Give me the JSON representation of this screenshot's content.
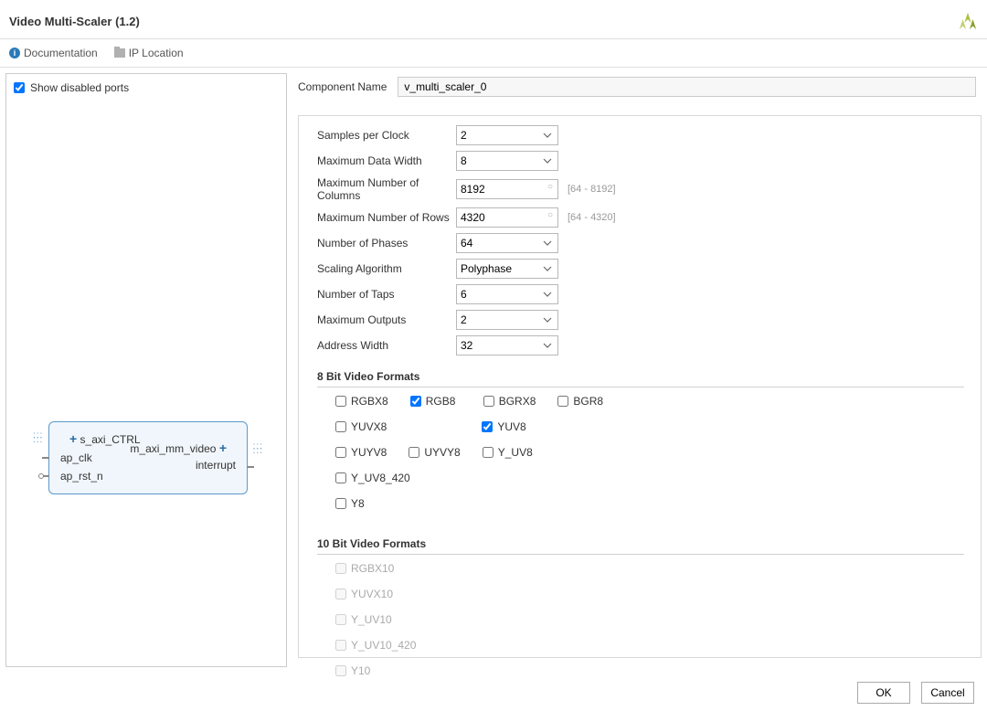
{
  "header": {
    "title": "Video Multi-Scaler (1.2)"
  },
  "toolbar": {
    "doc_label": "Documentation",
    "ip_loc_label": "IP Location"
  },
  "left_panel": {
    "show_disabled_ports_label": "Show disabled ports",
    "show_disabled_ports_checked": true,
    "block": {
      "s_axi_ctrl": "s_axi_CTRL",
      "ap_clk": "ap_clk",
      "ap_rst_n": "ap_rst_n",
      "m_axi_mm_video": "m_axi_mm_video",
      "interrupt": "interrupt"
    }
  },
  "component": {
    "name_label": "Component Name",
    "name_value": "v_multi_scaler_0"
  },
  "config": {
    "samples_per_clock": {
      "label": "Samples per Clock",
      "value": "2"
    },
    "max_data_width": {
      "label": "Maximum Data Width",
      "value": "8"
    },
    "max_cols": {
      "label": "Maximum Number of Columns",
      "value": "8192",
      "range": "[64 - 8192]"
    },
    "max_rows": {
      "label": "Maximum Number of Rows",
      "value": "4320",
      "range": "[64 - 4320]"
    },
    "num_phases": {
      "label": "Number of Phases",
      "value": "64"
    },
    "scaling_algo": {
      "label": "Scaling Algorithm",
      "value": "Polyphase"
    },
    "num_taps": {
      "label": "Number of Taps",
      "value": "6"
    },
    "max_outputs": {
      "label": "Maximum Outputs",
      "value": "2"
    },
    "addr_width": {
      "label": "Address Width",
      "value": "32"
    }
  },
  "sections": {
    "eight_bit": "8 Bit Video Formats",
    "ten_bit": "10 Bit Video Formats"
  },
  "formats8": [
    {
      "label": "RGBX8",
      "checked": false
    },
    {
      "label": "RGB8",
      "checked": true
    },
    {
      "label": "BGRX8",
      "checked": false
    },
    {
      "label": "BGR8",
      "checked": false
    },
    {
      "label": "YUVX8",
      "checked": false
    },
    {
      "label": "YUV8",
      "checked": true
    },
    {
      "label": "YUYV8",
      "checked": false
    },
    {
      "label": "UYVY8",
      "checked": false
    },
    {
      "label": "Y_UV8",
      "checked": false
    },
    {
      "label": "Y_UV8_420",
      "checked": false
    },
    {
      "label": "Y8",
      "checked": false
    }
  ],
  "formats10": [
    {
      "label": "RGBX10",
      "checked": false
    },
    {
      "label": "YUVX10",
      "checked": false
    },
    {
      "label": "Y_UV10",
      "checked": false
    },
    {
      "label": "Y_UV10_420",
      "checked": false
    },
    {
      "label": "Y10",
      "checked": false
    }
  ],
  "footer": {
    "ok": "OK",
    "cancel": "Cancel"
  }
}
